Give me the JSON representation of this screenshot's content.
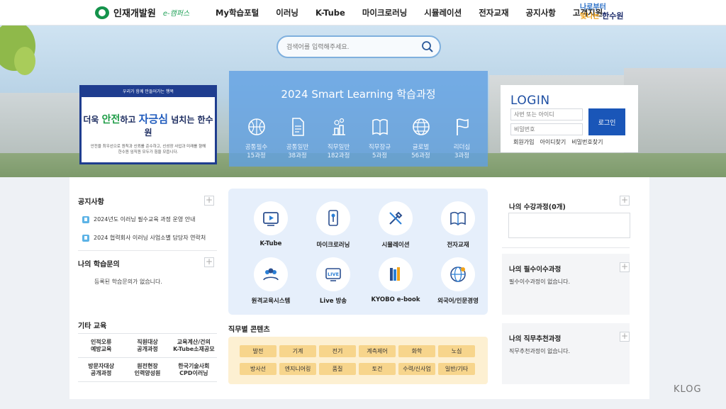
{
  "nav": {
    "logo_text": "인재개발원",
    "logo_sub": "e-캠퍼스",
    "menu": [
      "My학습포털",
      "이러닝",
      "K-Tube",
      "마이크로러닝",
      "시뮬레이션",
      "전자교재",
      "공지사항",
      "고객지원"
    ],
    "brand": {
      "line1": "나로부터",
      "line2": "빛나는",
      "line3": "한수원"
    }
  },
  "search": {
    "placeholder": "검색어를 입력해주세요."
  },
  "banner": {
    "top": "우리가 함께 만들어가는 행복",
    "headline_pre": "더욱 ",
    "headline_k1": "안전",
    "headline_mid": "하고 ",
    "headline_k2": "자긍심",
    "headline_post": " 넘치는 한수원",
    "desc": "안전을 최우선으로 원칙과 신뢰를 준수하고, 신성장 사업과 미래를 향해 한수원 임직원 모두가 힘을 모읍니다."
  },
  "learning": {
    "title": "2024 Smart Learning 학습과정",
    "courses": [
      {
        "name": "공통필수",
        "count": "15과정",
        "icon": "basketball-icon"
      },
      {
        "name": "공통일반",
        "count": "38과정",
        "icon": "document-icon"
      },
      {
        "name": "직무일반",
        "count": "182과정",
        "icon": "plant-icon"
      },
      {
        "name": "직무장규",
        "count": "5과정",
        "icon": "book-icon"
      },
      {
        "name": "글로벌",
        "count": "56과정",
        "icon": "globe-icon"
      },
      {
        "name": "리더십",
        "count": "3과정",
        "icon": "flag-icon"
      }
    ]
  },
  "login": {
    "title": "LOGIN",
    "id_placeholder": "사번 또는 아이디",
    "pw_placeholder": "비밀번호",
    "button": "로그인",
    "links": [
      "회원가입",
      "아이디찾기",
      "비밀번호찾기"
    ]
  },
  "notice": {
    "title": "공지사항",
    "items": [
      "2024년도 이러닝 필수교육 과정 운영 안내",
      "2024 협력회사 이러닝 사업소별 담당자 연락처"
    ]
  },
  "inquiry": {
    "title": "나의 학습문의",
    "empty": "등록된 학습문의가 없습니다."
  },
  "etc": {
    "title": "기타 교육",
    "items": [
      "인적오류\n예방교육",
      "직원대상\n공개과정",
      "교육계산/건의\nK-Tube소재공모",
      "방문자대상\n공개과정",
      "원전현장\n인력양성원",
      "한국기술사회\nCPD이러닝"
    ]
  },
  "services": [
    {
      "label": "K-Tube",
      "icon": "play-icon"
    },
    {
      "label": "마이크로러닝",
      "icon": "touch-icon"
    },
    {
      "label": "시뮬레이션",
      "icon": "tools-icon"
    },
    {
      "label": "전자교재",
      "icon": "open-book-icon"
    },
    {
      "label": "원격교육시스템",
      "icon": "group-icon"
    },
    {
      "label": "Live 방송",
      "icon": "live-icon"
    },
    {
      "label": "KYOBO e-book",
      "icon": "books-icon"
    },
    {
      "label": "외국어/인문경영",
      "icon": "globe-icon"
    }
  ],
  "jobs": {
    "title": "직무별 콘텐츠",
    "items": [
      "발전",
      "기계",
      "전기",
      "계측제어",
      "화학",
      "노심",
      "방사선",
      "엔지니어링",
      "품질",
      "토건",
      "수력/신사업",
      "일반/기타"
    ]
  },
  "right": {
    "mycourse_title": "나의 수강과정(0개)",
    "required_title": "나의 필수이수과정",
    "required_empty": "필수이수과정이 없습니다.",
    "recommend_title": "나의 직무추천과정",
    "recommend_empty": "직무추천과정이 없습니다."
  },
  "watermark": "KLOG"
}
